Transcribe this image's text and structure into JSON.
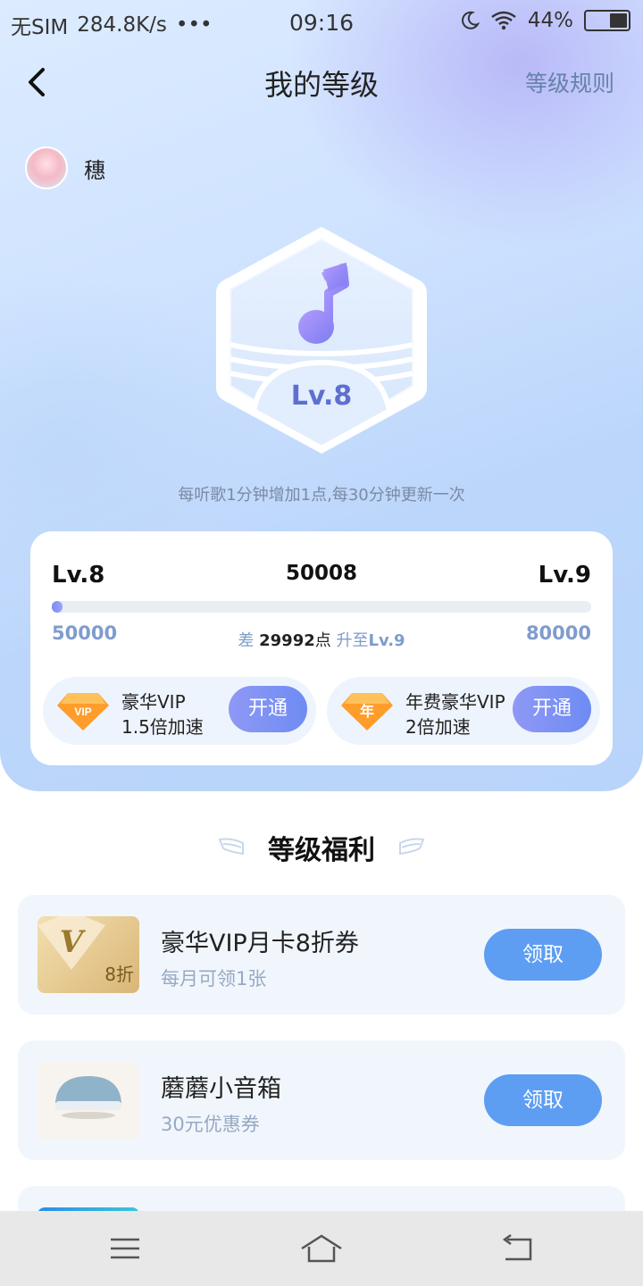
{
  "status_bar": {
    "carrier": "无SIM",
    "speed": "284.8K/s",
    "dots": "•••",
    "time": "09:16",
    "battery": "44%",
    "battery_level": 0.44
  },
  "nav": {
    "title": "我的等级",
    "rules_link": "等级规则"
  },
  "user": {
    "name": "穗"
  },
  "badge": {
    "level_label": "Lv.8",
    "icon": "music-note-icon"
  },
  "tip": "每听歌1分钟增加1点,每30分钟更新一次",
  "level_card": {
    "current_level": "Lv.8",
    "points": "50008",
    "next_level": "Lv.9",
    "range_min": "50000",
    "range_max": "80000",
    "progress": 0.0003,
    "diff_prefix": "差",
    "diff_value": "29992",
    "diff_unit": "点",
    "diff_mid": "升至",
    "diff_target": "Lv.9"
  },
  "vip_options": [
    {
      "gem_text": "VIP",
      "line1": "豪华VIP",
      "line2": "1.5倍加速",
      "button": "开通"
    },
    {
      "gem_text": "年",
      "line1": "年费豪华VIP",
      "line2": "2倍加速",
      "button": "开通"
    }
  ],
  "benefits": {
    "title": "等级福利",
    "items": [
      {
        "name": "豪华VIP月卡8折券",
        "sub": "每月可领1张",
        "button": "领取",
        "thumb_text": "8折",
        "thumb_letter": "V"
      },
      {
        "name": "蘑蘑小音箱",
        "sub": "30元优惠券",
        "button": "领取"
      }
    ]
  },
  "colors": {
    "accent_blue": "#5d9ef3",
    "vip_button": "#7f92f4",
    "level_text": "#5f6fd0"
  }
}
